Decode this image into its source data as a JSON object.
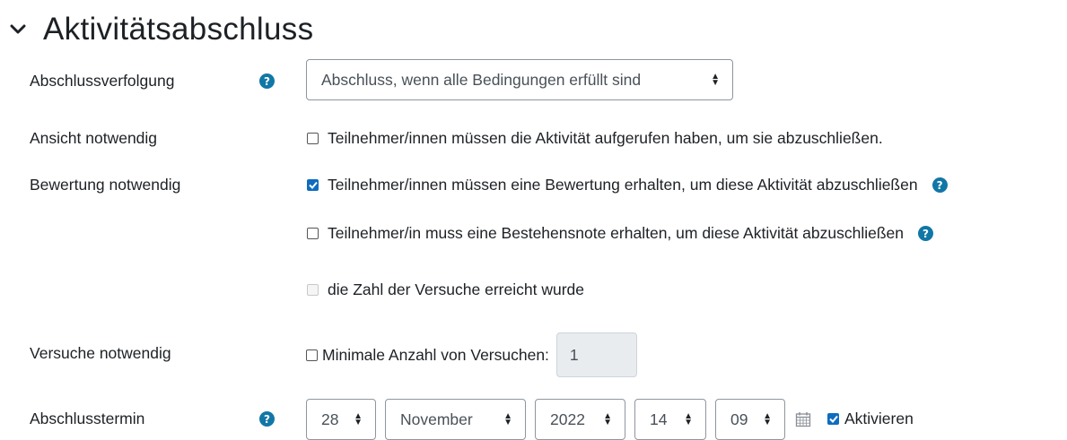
{
  "section": {
    "title": "Aktivitätsabschluss"
  },
  "tracking": {
    "label": "Abschlussverfolgung",
    "selected": "Abschluss, wenn alle Bedingungen erfüllt sind"
  },
  "view": {
    "label": "Ansicht notwendig",
    "checkbox_label": "Teilnehmer/innen müssen die Aktivität aufgerufen haben, um sie abzuschließen."
  },
  "grade": {
    "label": "Bewertung notwendig",
    "receive_grade_label": "Teilnehmer/innen müssen eine Bewertung erhalten, um diese Aktivität abzuschließen",
    "receive_grade_checked": true,
    "pass_grade_label": "Teilnehmer/in muss eine Bestehensnote erhalten, um diese Aktivität abzuschließen",
    "pass_grade_checked": false,
    "attempts_exhausted_label": "die Zahl der Versuche erreicht wurde"
  },
  "attempts": {
    "label": "Versuche notwendig",
    "checkbox_label": "Minimale Anzahl von Versuchen:",
    "value": "1"
  },
  "expected": {
    "label": "Abschlusstermin",
    "day": "28",
    "month": "November",
    "year": "2022",
    "hour": "14",
    "minute": "09",
    "enable_label": "Aktivieren",
    "enable_checked": true
  },
  "colors": {
    "accent": "#0f6cbf",
    "help": "#1177a6"
  }
}
